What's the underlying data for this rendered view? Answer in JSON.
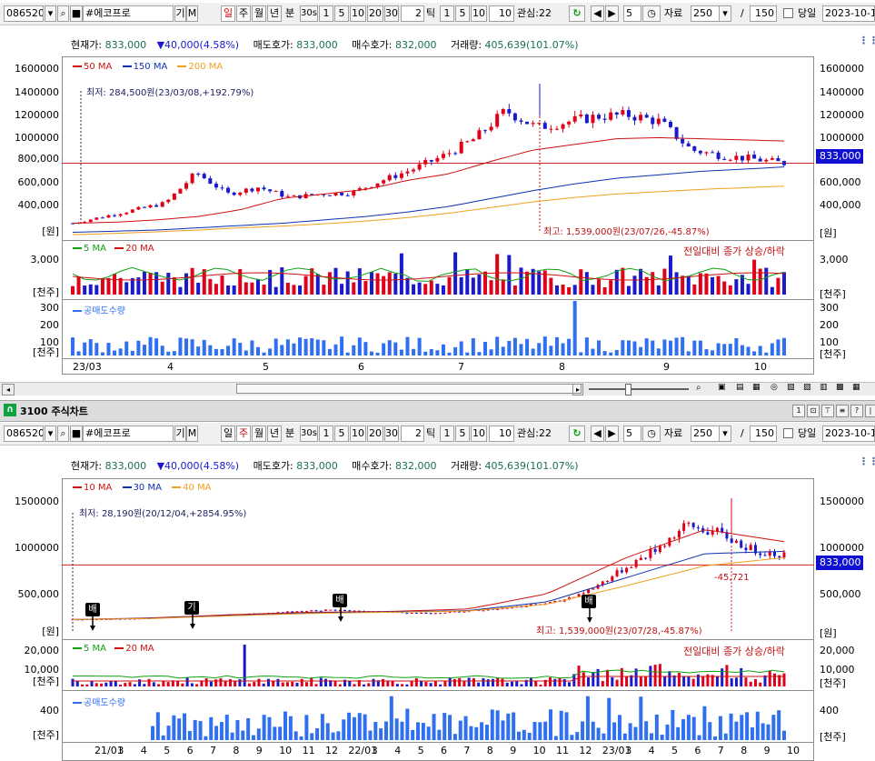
{
  "toolbar": {
    "code": "086520",
    "name": "#에코프로",
    "btn_gi": "기",
    "btn_m": "M",
    "periods": [
      "일",
      "주",
      "월",
      "년",
      "분"
    ],
    "top_selected": "일",
    "bottom_selected": "주",
    "intervals": [
      "30s",
      "1",
      "5",
      "10",
      "20",
      "30"
    ],
    "tick_count": "2",
    "tick_label": "틱",
    "tick_opts": [
      "1",
      "5",
      "10"
    ],
    "range_value": "10",
    "watch_label": "관심:22",
    "num_value": "5",
    "data_label": "자료",
    "data_count": "250",
    "slash": "/",
    "max_count": "150",
    "same_day_label": "당일",
    "date": "2023-10-1"
  },
  "top": {
    "info": {
      "price_label": "현재가:",
      "price": "833,000",
      "change": "40,000(4.58%)",
      "ask_label": "매도호가:",
      "ask": "833,000",
      "bid_label": "매수호가:",
      "bid": "832,000",
      "vol_label": "거래량:",
      "vol": "405,639(101.07%)"
    },
    "legend": [
      "50 MA",
      "150 MA",
      "200 MA"
    ],
    "y_ticks": [
      "1600000",
      "1400000",
      "1200000",
      "1000000",
      "800,000",
      "600,000",
      "400,000"
    ],
    "unit": "[원]",
    "current_price_box": "833,000",
    "low_label": "최저: 284,500원(23/03/08,+192.79%)",
    "high_label": "최고: 1,539,000원(23/07/26,-45.87%)",
    "vol_legend": [
      "5 MA",
      "20 MA"
    ],
    "vol_note": "전일대비 종가 상승/하락",
    "vol_ticks": [
      "3,000"
    ],
    "vol_unit": "[천주]",
    "short_legend": "공매도수량",
    "short_ticks": [
      "300",
      "200",
      "100"
    ],
    "short_unit": "[천주]",
    "x_labels": [
      "23/03",
      "4",
      "5",
      "6",
      "7",
      "8",
      "9",
      "10"
    ]
  },
  "window_title": "3100 주식차트",
  "bottom": {
    "info": {
      "price_label": "현재가:",
      "price": "833,000",
      "change": "40,000(4.58%)",
      "ask_label": "매도호가:",
      "ask": "833,000",
      "bid_label": "매수호가:",
      "bid": "832,000",
      "vol_label": "거래량:",
      "vol": "405,639(101.07%)"
    },
    "legend": [
      "10 MA",
      "30 MA",
      "40 MA"
    ],
    "y_ticks": [
      "1500000",
      "1000000",
      "500,000"
    ],
    "unit": "[원]",
    "current_price_box": "833,000",
    "low_label": "최저: 28,190원(20/12/04,+2854.95%)",
    "high_label": "최고: 1,539,000원(23/07/28,-45.87%)",
    "cross_value": "-45,721",
    "markers": [
      "배",
      "기",
      "배",
      "배"
    ],
    "vol_legend": [
      "5 MA",
      "20 MA"
    ],
    "vol_note": "전일대비 종가 상승/하락",
    "vol_ticks": [
      "20,000",
      "10,000"
    ],
    "vol_unit": "[천주]",
    "short_legend": "공매도수량",
    "short_ticks": [
      "400"
    ],
    "short_unit": "[천주]",
    "x_labels": [
      "21/01",
      "3",
      "4",
      "5",
      "6",
      "7",
      "8",
      "9",
      "10",
      "11",
      "12",
      "22/01",
      "3",
      "4",
      "5",
      "6",
      "7",
      "8",
      "9",
      "10",
      "11",
      "12",
      "23/01",
      "3",
      "4",
      "5",
      "6",
      "7",
      "8",
      "9",
      "10"
    ]
  },
  "colors": {
    "up": "#e0001a",
    "down": "#1a1acc",
    "ma_red": "#cc1010",
    "ma_blue": "#1030b0",
    "ma_orange": "#f0a020",
    "ma_green": "#10a010",
    "short_bar": "#3070f0",
    "price_box": "#1010d0"
  },
  "chart_data": [
    {
      "type": "candlestick",
      "title": "",
      "series": [
        {
          "name": "50 MA",
          "values": [
            300000,
            310000,
            330000,
            360000,
            420000,
            520000,
            560000,
            600000,
            680000,
            740000,
            850000,
            950000,
            1000000,
            1050000,
            1060000,
            1050000,
            1040000,
            1030000
          ]
        },
        {
          "name": "150 MA",
          "values": [
            220000,
            230000,
            240000,
            260000,
            280000,
            300000,
            330000,
            360000,
            400000,
            450000,
            520000,
            590000,
            650000,
            700000,
            730000,
            760000,
            780000,
            800000
          ]
        },
        {
          "name": "200 MA",
          "values": [
            200000,
            210000,
            225000,
            240000,
            260000,
            275000,
            295000,
            320000,
            350000,
            390000,
            440000,
            490000,
            530000,
            560000,
            580000,
            600000,
            615000,
            630000
          ]
        }
      ],
      "close": [
        300000,
        360000,
        420000,
        480000,
        750000,
        560000,
        620000,
        530000,
        560000,
        570000,
        680000,
        780000,
        900000,
        1050000,
        1300000,
        1150000,
        1200000,
        1250000,
        1260000,
        1200000,
        950000,
        900000,
        870000,
        833000
      ],
      "ylim": [
        200000,
        1700000
      ],
      "current": 833000,
      "low": 284500,
      "high": 1539000
    }
  ]
}
